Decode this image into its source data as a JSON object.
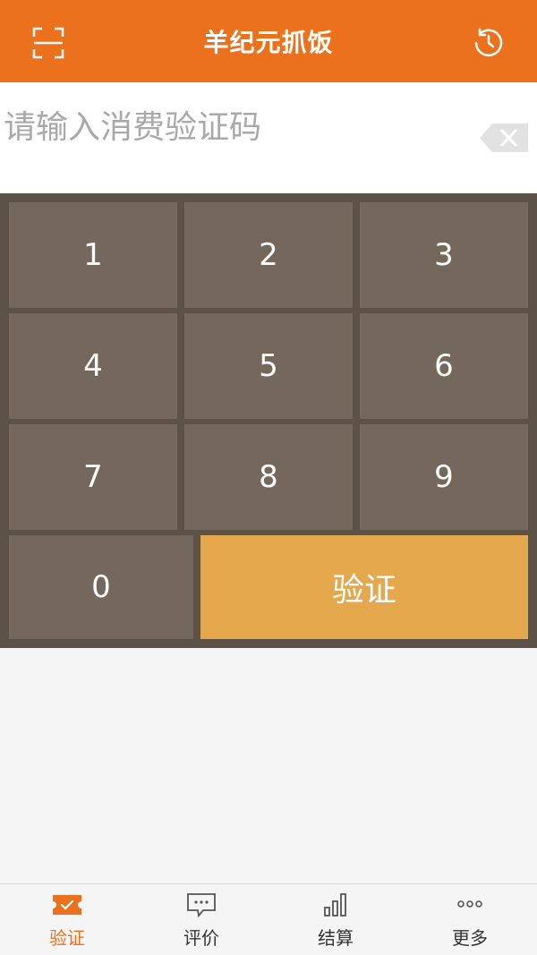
{
  "header": {
    "title": "羊纪元抓饭",
    "left_icon": "scan-icon",
    "right_icon": "history-icon",
    "color": "#ec711c"
  },
  "input": {
    "placeholder": "请输入消费验证码",
    "value": "",
    "clear_icon": "backspace-icon"
  },
  "keypad": {
    "keys": [
      "1",
      "2",
      "3",
      "4",
      "5",
      "6",
      "7",
      "8",
      "9",
      "0"
    ],
    "verify_label": "验证",
    "key_color": "#73685b",
    "verify_color": "#e6a84c"
  },
  "nav": {
    "items": [
      {
        "label": "验证",
        "icon": "ticket-check-icon",
        "active": true
      },
      {
        "label": "评价",
        "icon": "comment-icon",
        "active": false
      },
      {
        "label": "结算",
        "icon": "bar-chart-icon",
        "active": false
      },
      {
        "label": "更多",
        "icon": "more-dots-icon",
        "active": false
      }
    ],
    "active_color": "#ec711c"
  }
}
